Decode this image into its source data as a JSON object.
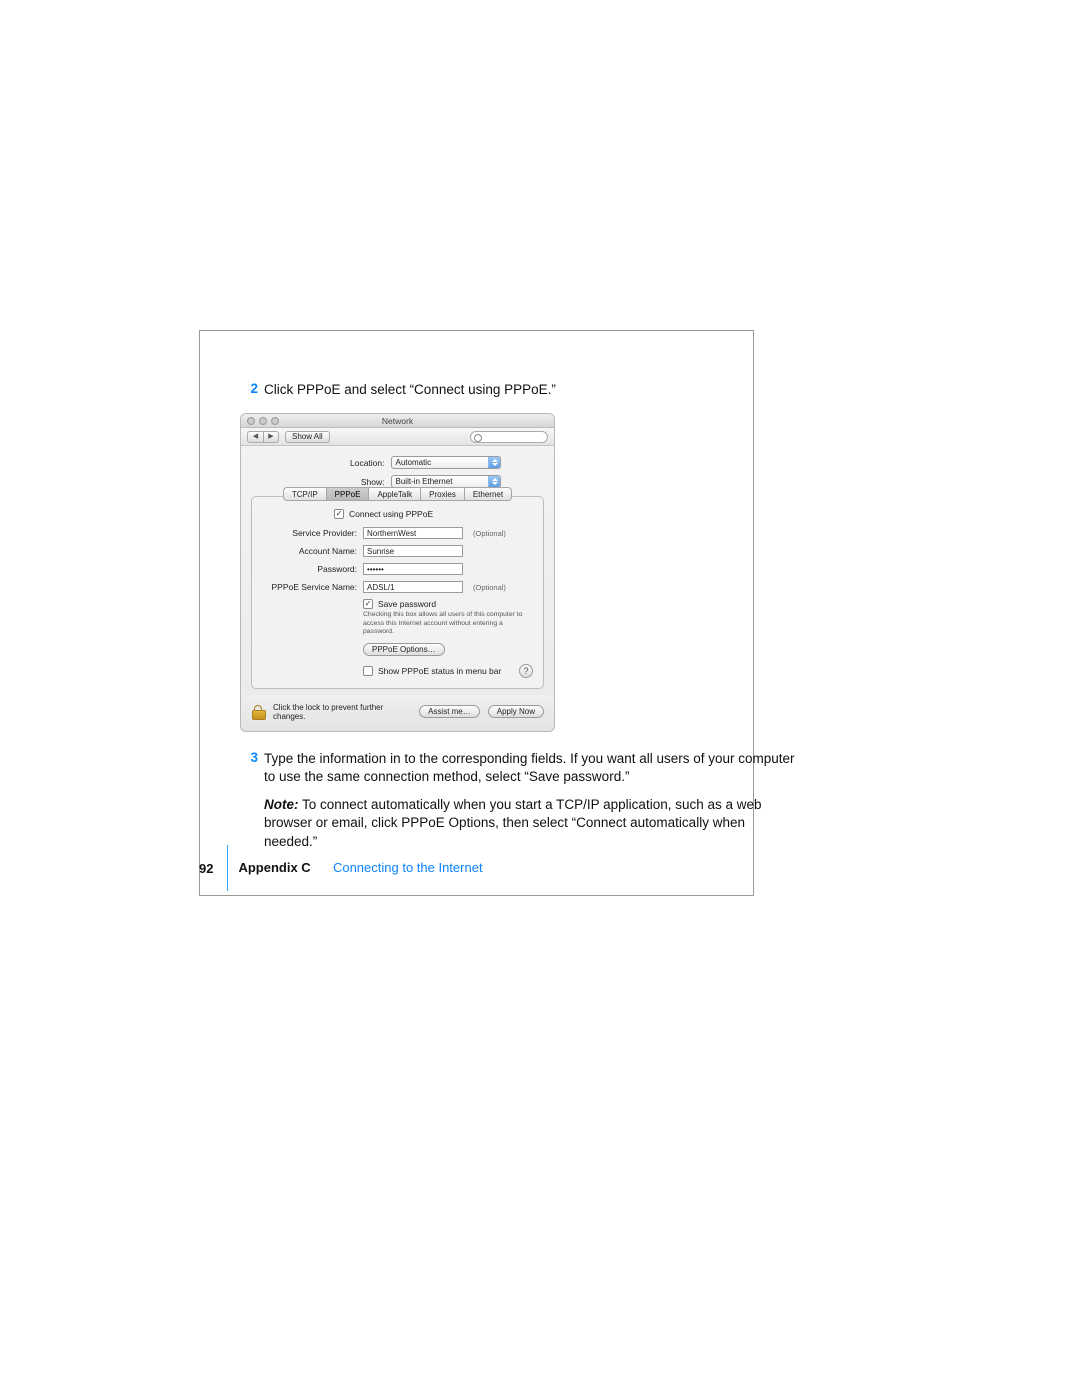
{
  "steps": {
    "s2": {
      "num": "2",
      "text": "Click PPPoE and select “Connect using PPPoE.”"
    },
    "s3": {
      "num": "3",
      "text": "Type the information in to the corresponding fields. If you want all users of your computer to use the same connection method, select “Save password.”"
    },
    "note_label": "Note:",
    "note_text": "  To connect automatically when you start a TCP/IP application, such as a web browser or email, click PPPoE Options, then select “Connect automatically when needed.”"
  },
  "window": {
    "title": "Network",
    "toolbar": {
      "show_all": "Show All",
      "search_placeholder": ""
    },
    "selects": {
      "location_label": "Location:",
      "location_value": "Automatic",
      "show_label": "Show:",
      "show_value": "Built-in Ethernet"
    },
    "tabs": {
      "t1": "TCP/IP",
      "t2": "PPPoE",
      "t3": "AppleTalk",
      "t4": "Proxies",
      "t5": "Ethernet"
    },
    "connect_chk": "Connect using PPPoE",
    "fields": {
      "sp_label": "Service Provider:",
      "sp_value": "NorthernWest",
      "an_label": "Account Name:",
      "an_value": "Sunrise",
      "pw_label": "Password:",
      "pw_value": "••••••",
      "svc_label": "PPPoE Service Name:",
      "svc_value": "ADSL/1",
      "optional": "(Optional)"
    },
    "savepw": "Save password",
    "savepw_hint": "Checking this box allows all users of this computer to access this Internet account without entering a password.",
    "options_btn": "PPPoE Options…",
    "statusbar": "Show PPPoE status in menu bar",
    "help": "?",
    "lock_text": "Click the lock to prevent further changes.",
    "assist": "Assist me…",
    "apply": "Apply Now"
  },
  "footer": {
    "page": "92",
    "appendix": "Appendix C",
    "title": "Connecting to the Internet"
  }
}
